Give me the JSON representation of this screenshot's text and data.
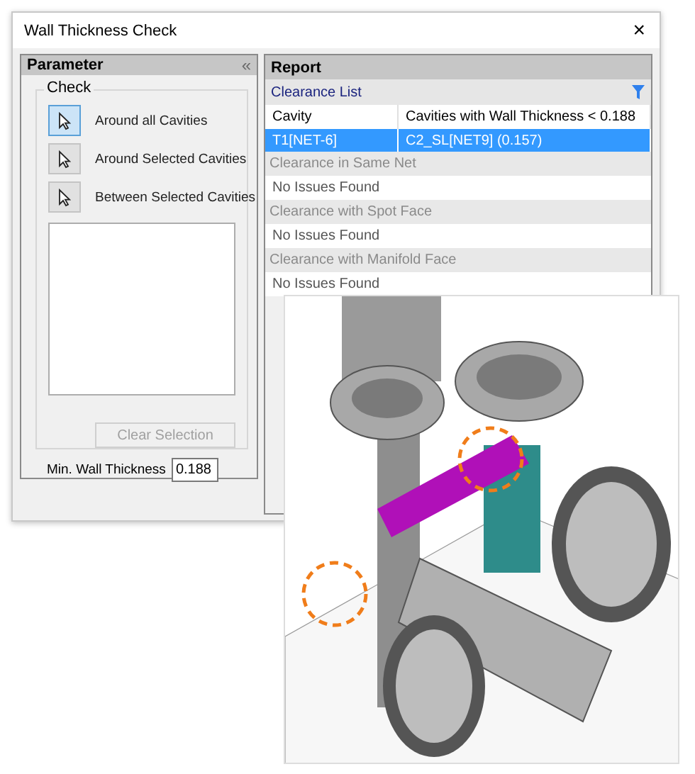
{
  "window": {
    "title": "Wall Thickness Check",
    "close": "×"
  },
  "parameter": {
    "title": "Parameter",
    "collapse": "«",
    "group": "Check",
    "modes": [
      {
        "label": "Around all Cavities",
        "selected": true
      },
      {
        "label": "Around Selected Cavities",
        "selected": false
      },
      {
        "label": "Between Selected Cavities",
        "selected": false
      }
    ],
    "clear_button": {
      "label": "Clear Selection",
      "disabled": true
    },
    "min_wall": {
      "label": "Min. Wall Thickness",
      "value": "0.188"
    }
  },
  "report": {
    "title": "Report",
    "list_title": "Clearance List",
    "columns": [
      "Cavity",
      "Cavities with Wall Thickness < 0.188"
    ],
    "rows": [
      {
        "cells": [
          "T1[NET-6]",
          "C2_SL[NET9] (0.157)"
        ],
        "selected": true
      }
    ],
    "sections": [
      {
        "title": "Clearance in Same Net",
        "message": "No Issues Found"
      },
      {
        "title": "Clearance with Spot Face",
        "message": "No Issues Found"
      },
      {
        "title": "Clearance with Manifold Face",
        "message": "No Issues Found"
      }
    ]
  }
}
